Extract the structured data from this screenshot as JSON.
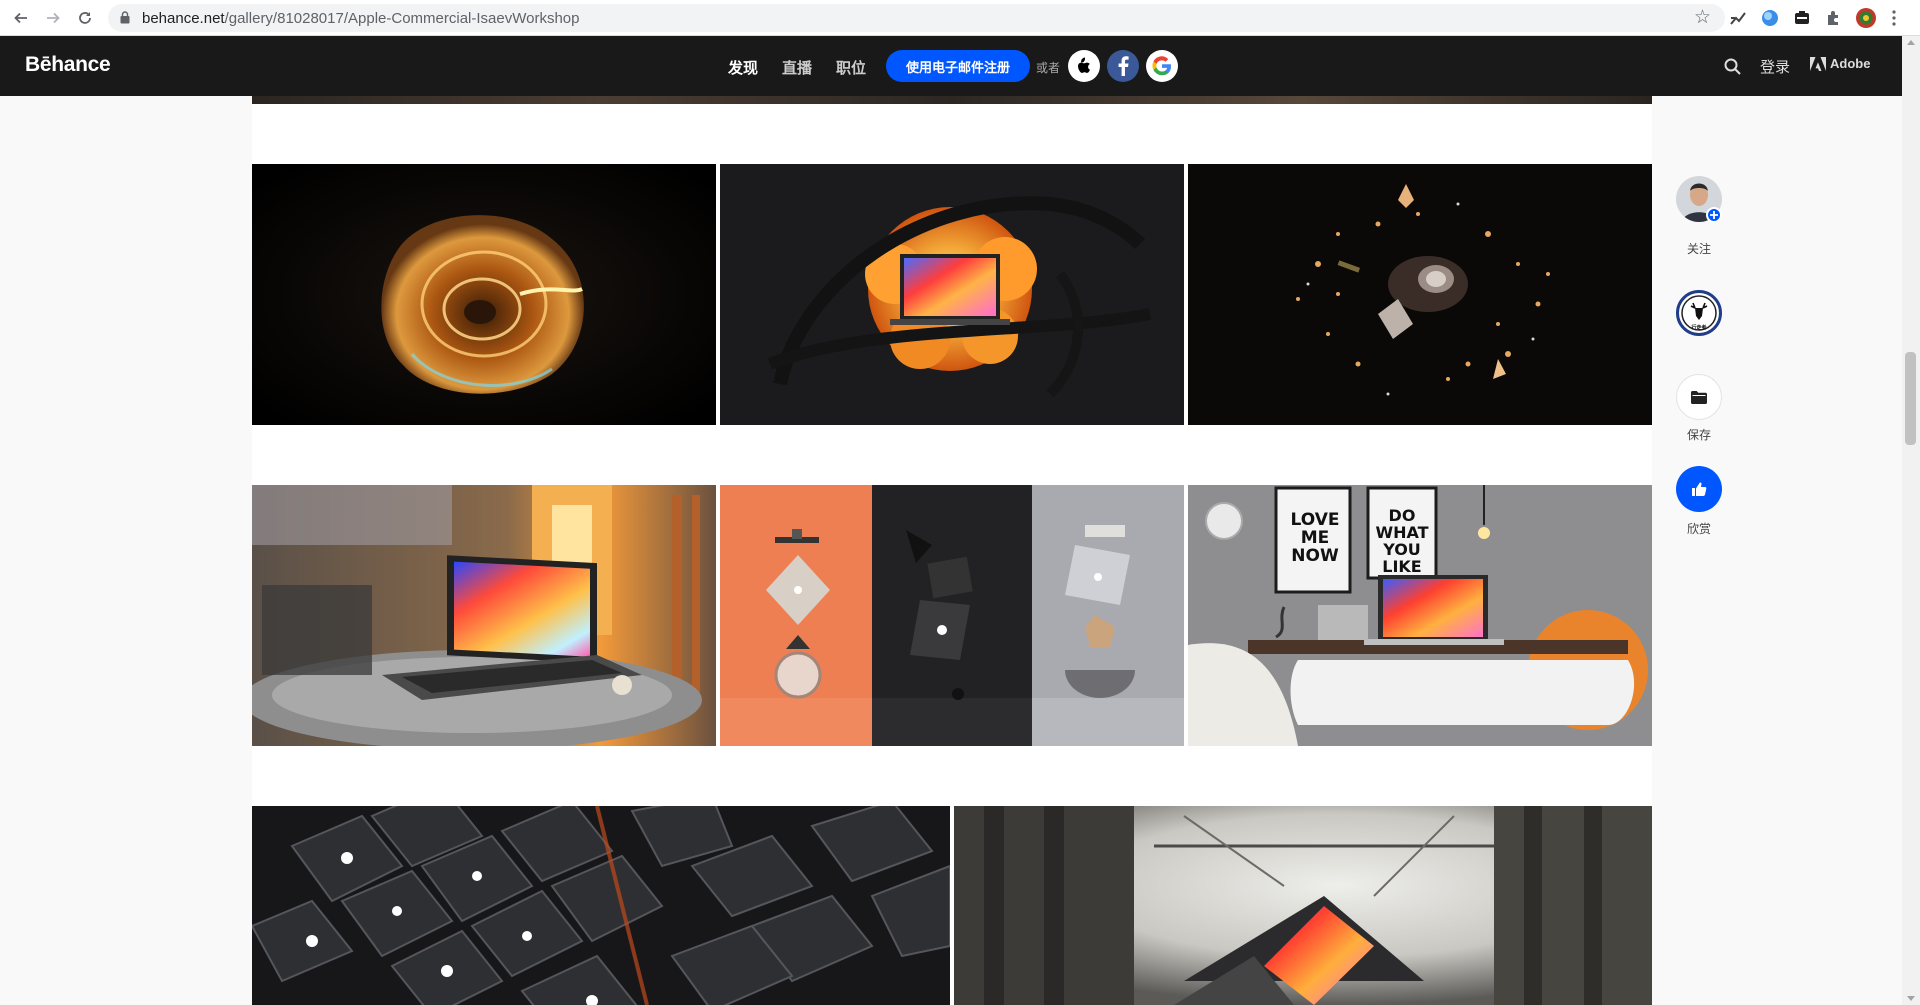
{
  "browser": {
    "url_host": "behance.net",
    "url_path": "/gallery/81028017/Apple-Commercial-IsaevWorkshop"
  },
  "header": {
    "logo": "Bēhance",
    "nav": [
      "发现",
      "直播",
      "职位"
    ],
    "signup_label": "使用电子邮件注册",
    "or_label": "或者",
    "login_label": "登录",
    "adobe_label": "Adobe"
  },
  "sidebar": {
    "follow_label": "关注",
    "save_label": "保存",
    "appreciate_label": "欣赏",
    "badge_text": "行走者"
  },
  "tiles": {
    "love_poster": [
      "LOVE",
      "ME",
      "NOW"
    ],
    "do_poster": [
      "DO",
      "WHAT",
      "YOU",
      "LIKE"
    ]
  },
  "colors": {
    "behance_blue": "#0057ff",
    "header_bg": "#191919",
    "facebook": "#3b5998"
  }
}
